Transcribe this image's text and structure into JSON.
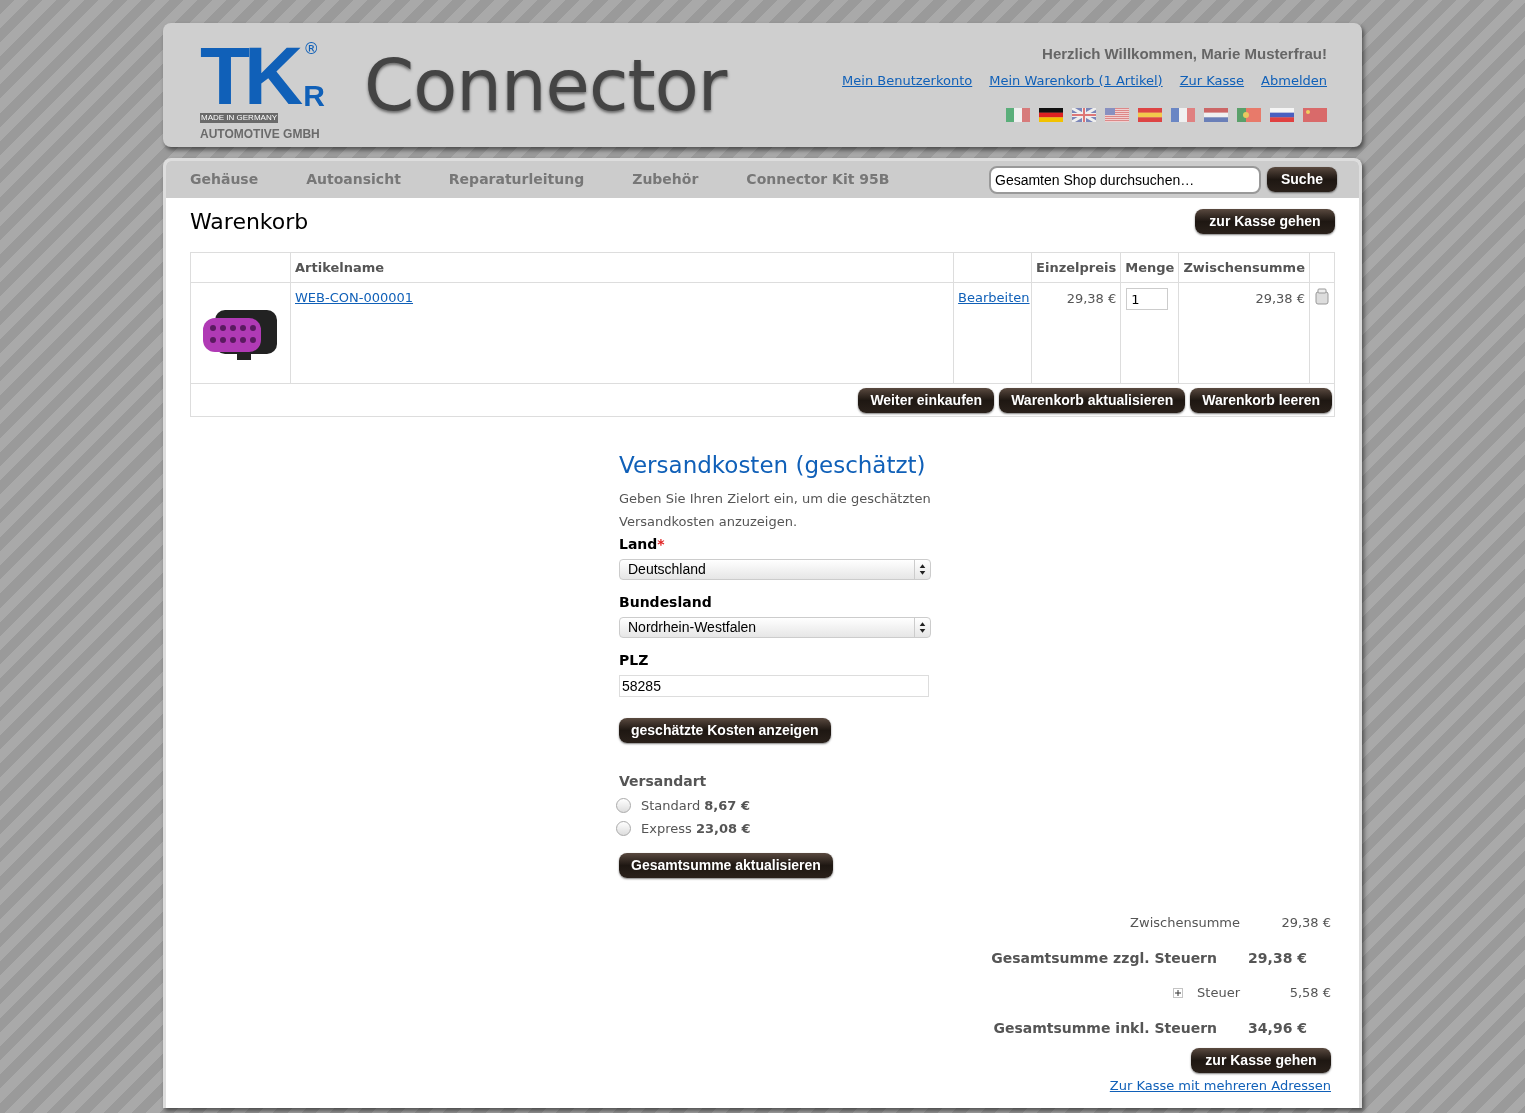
{
  "logo": {
    "letters": "TK",
    "small_letter": "R",
    "registered": "®",
    "made_in": "MADE IN GERMANY",
    "company": "AUTOMOTIVE GMBH",
    "wordmark": "Connector"
  },
  "header": {
    "welcome": "Herzlich Willkommen, Marie Musterfrau!",
    "links": [
      "Mein Benutzerkonto",
      "Mein Warenkorb (1 Artikel)",
      "Zur Kasse",
      "Abmelden"
    ]
  },
  "nav": {
    "items": [
      "Gehäuse",
      "Autoansicht",
      "Reparaturleitung",
      "Zubehör",
      "Connector Kit 95B"
    ],
    "search": {
      "placeholder": "Gesamten Shop durchsuchen…"
    },
    "search_button": "Suche"
  },
  "cart": {
    "title": "Warenkorb",
    "checkout_button": "zur Kasse gehen",
    "table": {
      "columns": [
        "Artikelname",
        "Einzelpreis",
        "Menge",
        "Zwischensumme"
      ],
      "rows": [
        {
          "name": "WEB-CON-000001",
          "edit": "Bearbeiten",
          "price": "29,38 €",
          "quantity": "1",
          "subtotal": "29,38 €"
        }
      ]
    },
    "buttons": [
      "Weiter einkaufen",
      "Warenkorb aktualisieren",
      "Warenkorb leeren"
    ]
  },
  "shipping": {
    "title": "Versandkosten (geschätzt)",
    "description": "Geben Sie Ihren Zielort ein, um die geschätzten Versandkosten anzuzeigen.",
    "country_label": "Land",
    "required_mark": "*",
    "country": "Deutschland",
    "state_label": "Bundesland",
    "state": "Nordrhein-Westfalen",
    "zip_label": "PLZ",
    "zip": "58285",
    "estimate_button": "geschätzte Kosten anzeigen",
    "method_label": "Versandart",
    "methods": [
      {
        "name": "Standard",
        "price": "8,67 €",
        "selected": false
      },
      {
        "name": "Express",
        "price": "23,08 €",
        "selected": false
      }
    ],
    "update_button": "Gesamtsumme aktualisieren"
  },
  "totals": {
    "rows": [
      {
        "kind": "plain",
        "label": "Zwischensumme",
        "value": "29,38 €"
      },
      {
        "kind": "bold",
        "label": "Gesamtsumme zzgl. Steuern",
        "value": "29,38 €"
      },
      {
        "kind": "tax",
        "label": "Steuer",
        "value": "5,58 €",
        "expanded": false
      },
      {
        "kind": "bold",
        "label": "Gesamtsumme inkl. Steuern",
        "value": "34,96 €"
      }
    ],
    "checkout_button": "zur Kasse gehen",
    "multi_link": "Zur Kasse mit mehreren Adressen"
  }
}
